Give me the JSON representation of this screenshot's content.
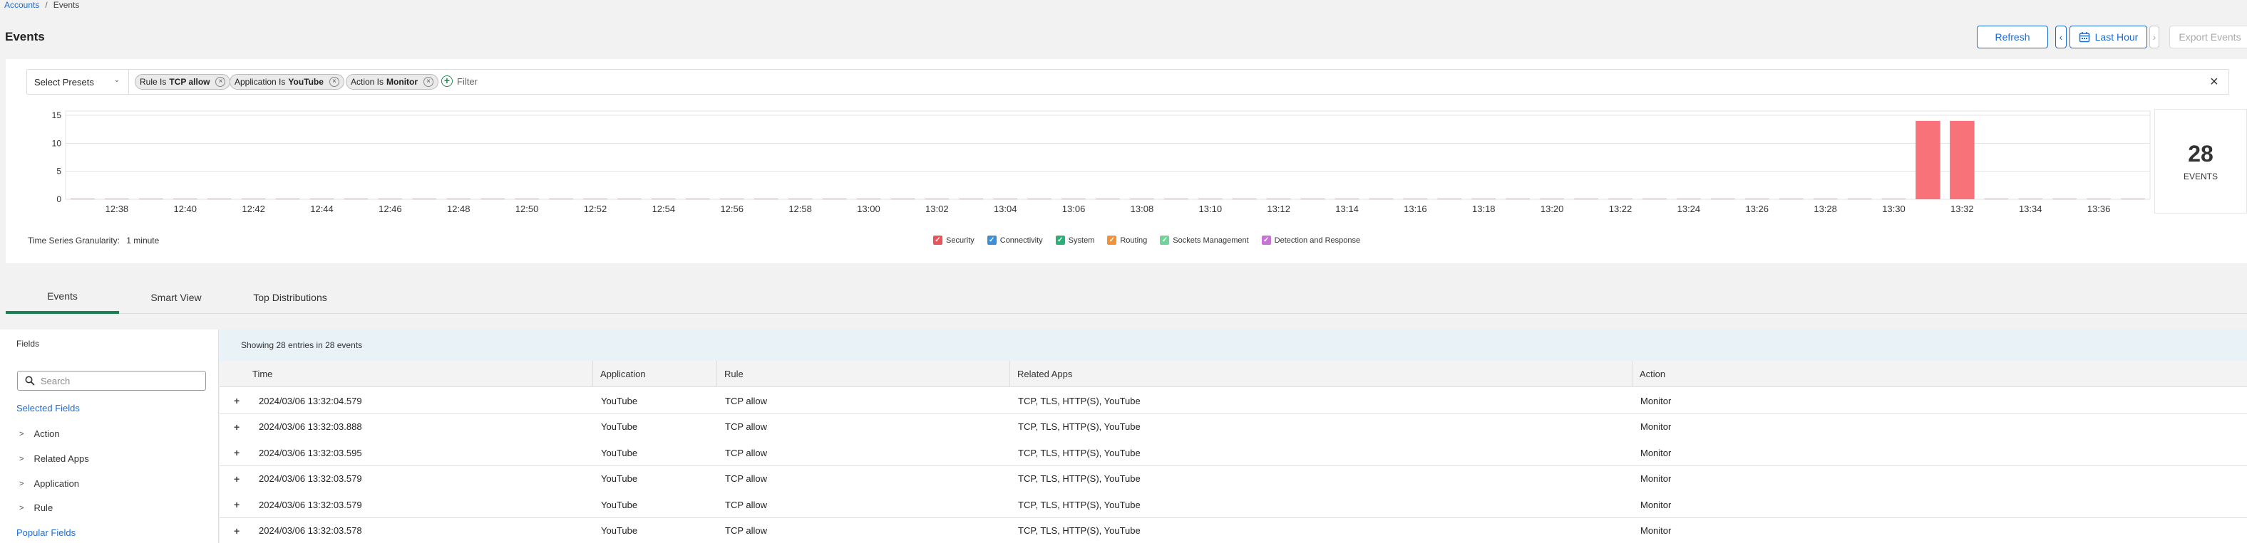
{
  "breadcrumb": {
    "parent": "Accounts",
    "separator": "/",
    "current": "Events"
  },
  "page_title": "Events",
  "toolbar": {
    "refresh": "Refresh",
    "time_range": "Last Hour",
    "export": "Export Events"
  },
  "filters": {
    "preset_placeholder": "Select Presets",
    "chips": [
      {
        "field": "Rule Is",
        "value": "TCP allow"
      },
      {
        "field": "Application Is",
        "value": "YouTube"
      },
      {
        "field": "Action Is",
        "value": "Monitor"
      }
    ],
    "add_label": "Filter"
  },
  "chart_data": {
    "type": "bar",
    "y_ticks": [
      0,
      5,
      10,
      15
    ],
    "ylim": [
      0,
      15
    ],
    "x_tick_labels": [
      "12:38",
      "12:40",
      "12:42",
      "12:44",
      "12:46",
      "12:48",
      "12:50",
      "12:52",
      "12:54",
      "12:56",
      "12:58",
      "13:00",
      "13:02",
      "13:04",
      "13:06",
      "13:08",
      "13:10",
      "13:12",
      "13:14",
      "13:16",
      "13:18",
      "13:20",
      "13:22",
      "13:24",
      "13:26",
      "13:28",
      "13:30",
      "13:32",
      "13:34",
      "13:36"
    ],
    "bar_color": "#f8727a",
    "bars": [
      {
        "time": "13:31",
        "value": 14
      },
      {
        "time": "13:32",
        "value": 14
      }
    ]
  },
  "total": {
    "count": "28",
    "label": "EVENTS"
  },
  "granularity": {
    "label": "Time Series Granularity:",
    "value": "1 minute"
  },
  "legend": [
    {
      "label": "Security",
      "color": "#e8545a"
    },
    {
      "label": "Connectivity",
      "color": "#3b8fd9"
    },
    {
      "label": "System",
      "color": "#2bb07a"
    },
    {
      "label": "Routing",
      "color": "#f0923a"
    },
    {
      "label": "Sockets Management",
      "color": "#6fd39a"
    },
    {
      "label": "Detection and Response",
      "color": "#c774d6"
    }
  ],
  "tabs": [
    "Events",
    "Smart View",
    "Top Distributions"
  ],
  "sidebar": {
    "title": "Fields",
    "search_placeholder": "Search",
    "selected_title": "Selected Fields",
    "selected_items": [
      "Action",
      "Related Apps",
      "Application",
      "Rule"
    ],
    "popular_title": "Popular Fields"
  },
  "table": {
    "info": "Showing 28 entries in 28 events",
    "columns": [
      "Time",
      "Application",
      "Rule",
      "Related Apps",
      "Action"
    ],
    "rows": [
      [
        "2024/03/06 13:32:04.579",
        "YouTube",
        "TCP allow",
        "TCP, TLS, HTTP(S), YouTube",
        "Monitor"
      ],
      [
        "2024/03/06 13:32:03.888",
        "YouTube",
        "TCP allow",
        "TCP, TLS, HTTP(S), YouTube",
        "Monitor"
      ],
      [
        "2024/03/06 13:32:03.595",
        "YouTube",
        "TCP allow",
        "TCP, TLS, HTTP(S), YouTube",
        "Monitor"
      ],
      [
        "2024/03/06 13:32:03.579",
        "YouTube",
        "TCP allow",
        "TCP, TLS, HTTP(S), YouTube",
        "Monitor"
      ],
      [
        "2024/03/06 13:32:03.579",
        "YouTube",
        "TCP allow",
        "TCP, TLS, HTTP(S), YouTube",
        "Monitor"
      ],
      [
        "2024/03/06 13:32:03.578",
        "YouTube",
        "TCP allow",
        "TCP, TLS, HTTP(S), YouTube",
        "Monitor"
      ]
    ]
  }
}
